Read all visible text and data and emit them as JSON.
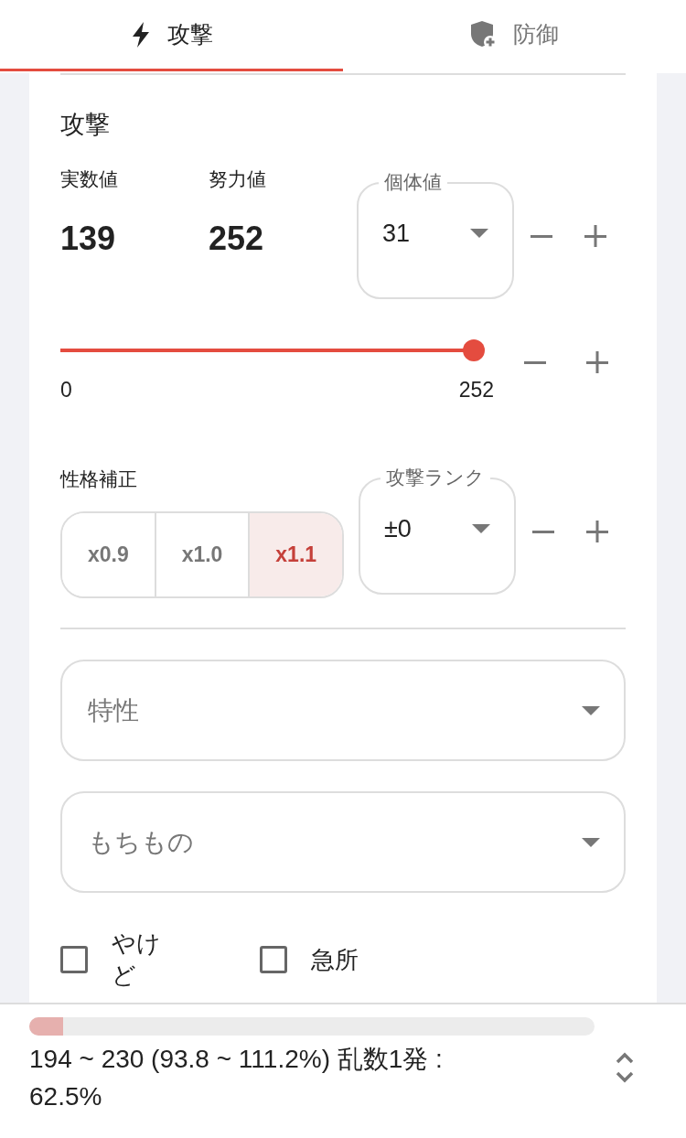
{
  "tabs": [
    {
      "label": "攻撃",
      "selected": true
    },
    {
      "label": "防御",
      "selected": false
    }
  ],
  "attack": {
    "title": "攻撃",
    "stat": {
      "label": "実数値",
      "value": "139"
    },
    "ev": {
      "label": "努力値",
      "value": "252"
    },
    "iv": {
      "label": "個体値",
      "value": "31"
    },
    "ev_slider": {
      "level": 1,
      "min_label": "0",
      "max_label": "252"
    },
    "nature": {
      "label": "性格補正",
      "options": [
        {
          "label": "x0.9",
          "selected": false
        },
        {
          "label": "x1.0",
          "selected": false
        },
        {
          "label": "x1.1",
          "selected": true
        }
      ]
    },
    "rank": {
      "label": "攻撃ランク",
      "value": "±0"
    },
    "selects": [
      {
        "placeholder": "特性"
      },
      {
        "placeholder": "もちもの"
      }
    ],
    "checkboxes": [
      {
        "label": "やけど",
        "checked": false
      },
      {
        "label": "急所",
        "checked": false
      }
    ]
  },
  "result": {
    "level": 0.06,
    "text": "194 ~ 230 (93.8 ~ 111.2%) 乱数1発 : 62.5%"
  }
}
